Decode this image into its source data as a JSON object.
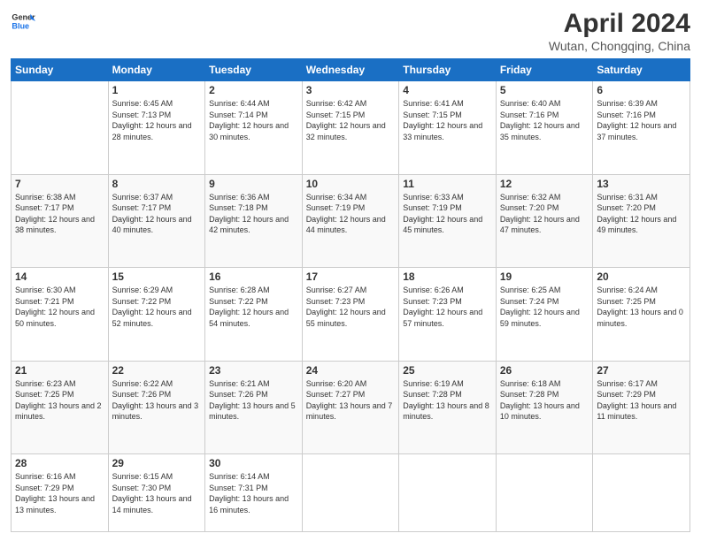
{
  "header": {
    "logo_line1": "General",
    "logo_line2": "Blue",
    "title": "April 2024",
    "subtitle": "Wutan, Chongqing, China"
  },
  "days_of_week": [
    "Sunday",
    "Monday",
    "Tuesday",
    "Wednesday",
    "Thursday",
    "Friday",
    "Saturday"
  ],
  "weeks": [
    [
      {
        "day": "",
        "sunrise": "",
        "sunset": "",
        "daylight": ""
      },
      {
        "day": "1",
        "sunrise": "Sunrise: 6:45 AM",
        "sunset": "Sunset: 7:13 PM",
        "daylight": "Daylight: 12 hours and 28 minutes."
      },
      {
        "day": "2",
        "sunrise": "Sunrise: 6:44 AM",
        "sunset": "Sunset: 7:14 PM",
        "daylight": "Daylight: 12 hours and 30 minutes."
      },
      {
        "day": "3",
        "sunrise": "Sunrise: 6:42 AM",
        "sunset": "Sunset: 7:15 PM",
        "daylight": "Daylight: 12 hours and 32 minutes."
      },
      {
        "day": "4",
        "sunrise": "Sunrise: 6:41 AM",
        "sunset": "Sunset: 7:15 PM",
        "daylight": "Daylight: 12 hours and 33 minutes."
      },
      {
        "day": "5",
        "sunrise": "Sunrise: 6:40 AM",
        "sunset": "Sunset: 7:16 PM",
        "daylight": "Daylight: 12 hours and 35 minutes."
      },
      {
        "day": "6",
        "sunrise": "Sunrise: 6:39 AM",
        "sunset": "Sunset: 7:16 PM",
        "daylight": "Daylight: 12 hours and 37 minutes."
      }
    ],
    [
      {
        "day": "7",
        "sunrise": "Sunrise: 6:38 AM",
        "sunset": "Sunset: 7:17 PM",
        "daylight": "Daylight: 12 hours and 38 minutes."
      },
      {
        "day": "8",
        "sunrise": "Sunrise: 6:37 AM",
        "sunset": "Sunset: 7:17 PM",
        "daylight": "Daylight: 12 hours and 40 minutes."
      },
      {
        "day": "9",
        "sunrise": "Sunrise: 6:36 AM",
        "sunset": "Sunset: 7:18 PM",
        "daylight": "Daylight: 12 hours and 42 minutes."
      },
      {
        "day": "10",
        "sunrise": "Sunrise: 6:34 AM",
        "sunset": "Sunset: 7:19 PM",
        "daylight": "Daylight: 12 hours and 44 minutes."
      },
      {
        "day": "11",
        "sunrise": "Sunrise: 6:33 AM",
        "sunset": "Sunset: 7:19 PM",
        "daylight": "Daylight: 12 hours and 45 minutes."
      },
      {
        "day": "12",
        "sunrise": "Sunrise: 6:32 AM",
        "sunset": "Sunset: 7:20 PM",
        "daylight": "Daylight: 12 hours and 47 minutes."
      },
      {
        "day": "13",
        "sunrise": "Sunrise: 6:31 AM",
        "sunset": "Sunset: 7:20 PM",
        "daylight": "Daylight: 12 hours and 49 minutes."
      }
    ],
    [
      {
        "day": "14",
        "sunrise": "Sunrise: 6:30 AM",
        "sunset": "Sunset: 7:21 PM",
        "daylight": "Daylight: 12 hours and 50 minutes."
      },
      {
        "day": "15",
        "sunrise": "Sunrise: 6:29 AM",
        "sunset": "Sunset: 7:22 PM",
        "daylight": "Daylight: 12 hours and 52 minutes."
      },
      {
        "day": "16",
        "sunrise": "Sunrise: 6:28 AM",
        "sunset": "Sunset: 7:22 PM",
        "daylight": "Daylight: 12 hours and 54 minutes."
      },
      {
        "day": "17",
        "sunrise": "Sunrise: 6:27 AM",
        "sunset": "Sunset: 7:23 PM",
        "daylight": "Daylight: 12 hours and 55 minutes."
      },
      {
        "day": "18",
        "sunrise": "Sunrise: 6:26 AM",
        "sunset": "Sunset: 7:23 PM",
        "daylight": "Daylight: 12 hours and 57 minutes."
      },
      {
        "day": "19",
        "sunrise": "Sunrise: 6:25 AM",
        "sunset": "Sunset: 7:24 PM",
        "daylight": "Daylight: 12 hours and 59 minutes."
      },
      {
        "day": "20",
        "sunrise": "Sunrise: 6:24 AM",
        "sunset": "Sunset: 7:25 PM",
        "daylight": "Daylight: 13 hours and 0 minutes."
      }
    ],
    [
      {
        "day": "21",
        "sunrise": "Sunrise: 6:23 AM",
        "sunset": "Sunset: 7:25 PM",
        "daylight": "Daylight: 13 hours and 2 minutes."
      },
      {
        "day": "22",
        "sunrise": "Sunrise: 6:22 AM",
        "sunset": "Sunset: 7:26 PM",
        "daylight": "Daylight: 13 hours and 3 minutes."
      },
      {
        "day": "23",
        "sunrise": "Sunrise: 6:21 AM",
        "sunset": "Sunset: 7:26 PM",
        "daylight": "Daylight: 13 hours and 5 minutes."
      },
      {
        "day": "24",
        "sunrise": "Sunrise: 6:20 AM",
        "sunset": "Sunset: 7:27 PM",
        "daylight": "Daylight: 13 hours and 7 minutes."
      },
      {
        "day": "25",
        "sunrise": "Sunrise: 6:19 AM",
        "sunset": "Sunset: 7:28 PM",
        "daylight": "Daylight: 13 hours and 8 minutes."
      },
      {
        "day": "26",
        "sunrise": "Sunrise: 6:18 AM",
        "sunset": "Sunset: 7:28 PM",
        "daylight": "Daylight: 13 hours and 10 minutes."
      },
      {
        "day": "27",
        "sunrise": "Sunrise: 6:17 AM",
        "sunset": "Sunset: 7:29 PM",
        "daylight": "Daylight: 13 hours and 11 minutes."
      }
    ],
    [
      {
        "day": "28",
        "sunrise": "Sunrise: 6:16 AM",
        "sunset": "Sunset: 7:29 PM",
        "daylight": "Daylight: 13 hours and 13 minutes."
      },
      {
        "day": "29",
        "sunrise": "Sunrise: 6:15 AM",
        "sunset": "Sunset: 7:30 PM",
        "daylight": "Daylight: 13 hours and 14 minutes."
      },
      {
        "day": "30",
        "sunrise": "Sunrise: 6:14 AM",
        "sunset": "Sunset: 7:31 PM",
        "daylight": "Daylight: 13 hours and 16 minutes."
      },
      {
        "day": "",
        "sunrise": "",
        "sunset": "",
        "daylight": ""
      },
      {
        "day": "",
        "sunrise": "",
        "sunset": "",
        "daylight": ""
      },
      {
        "day": "",
        "sunrise": "",
        "sunset": "",
        "daylight": ""
      },
      {
        "day": "",
        "sunrise": "",
        "sunset": "",
        "daylight": ""
      }
    ]
  ]
}
